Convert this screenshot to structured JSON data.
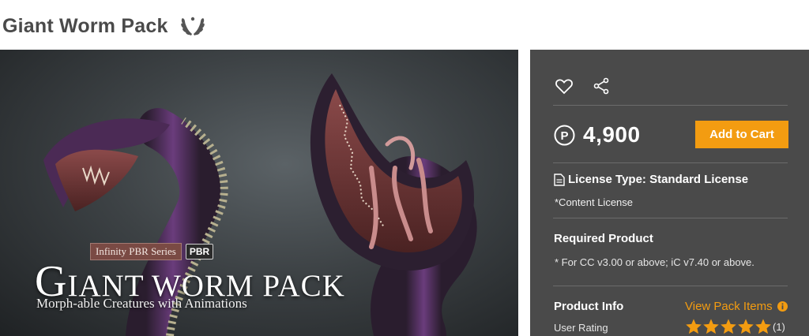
{
  "header": {
    "title": "Giant Worm Pack",
    "award_icon": "laurel-wreath-icon"
  },
  "hero": {
    "series_badge": "Infinity PBR Series",
    "pbr_badge": "PBR",
    "title_initial": "G",
    "title_rest": "IANT WORM PACK",
    "subtitle": "Morph-able Creatures with Animations"
  },
  "panel": {
    "wishlist_icon": "heart-icon",
    "share_icon": "share-icon",
    "price_symbol": "P",
    "price": "4,900",
    "add_to_cart": "Add to Cart",
    "license_icon": "document-icon",
    "license_label": "License Type: Standard License",
    "license_note": "*Content License",
    "required_title": "Required Product",
    "required_text": "* For CC v3.00 or above; iC v7.40 or above.",
    "info_title": "Product Info",
    "view_pack": "View Pack Items",
    "info_icon": "info-icon",
    "rating_label": "User Rating",
    "rating": 5,
    "rating_max": 5,
    "rating_count": "(1)"
  },
  "colors": {
    "accent": "#f39c11",
    "panel_bg": "#4a4a4a",
    "title_text": "#4a4a4a"
  }
}
